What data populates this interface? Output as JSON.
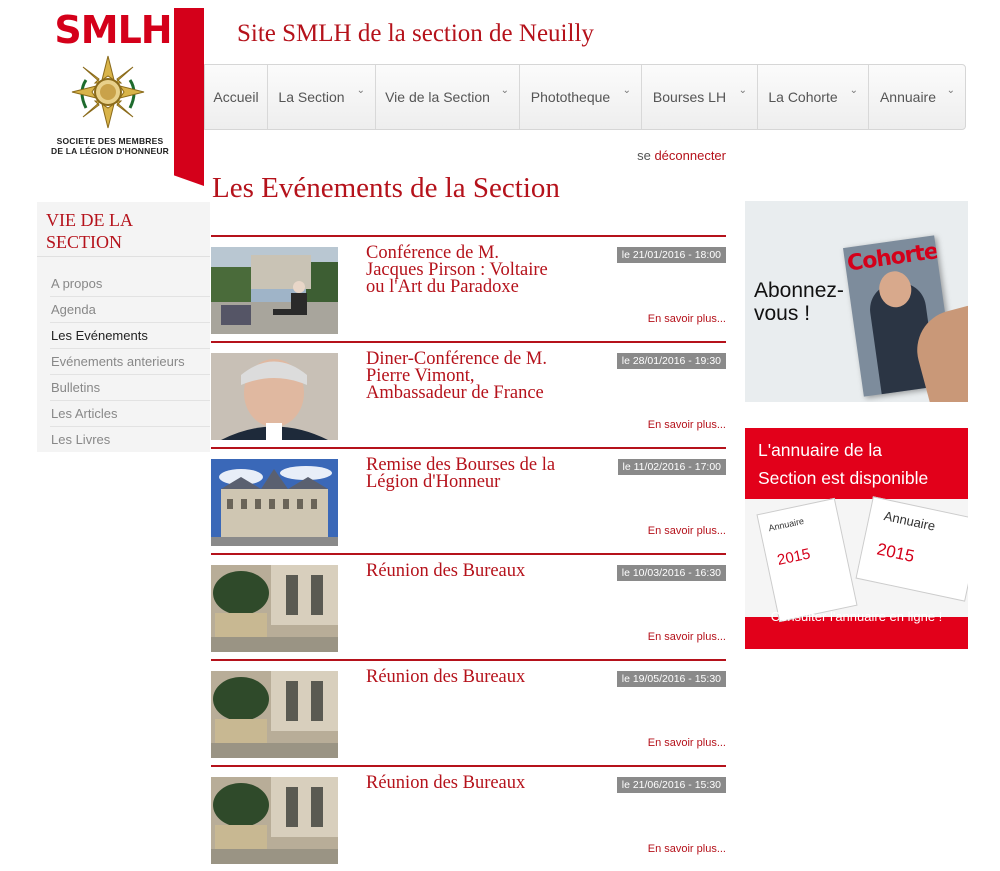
{
  "logo": {
    "text": "SMLH",
    "caption_line1": "SOCIETE DES MEMBRES",
    "caption_line2": "DE LA LÉGION D'HONNEUR"
  },
  "site_title": "Site SMLH de la section de Neuilly",
  "nav": [
    {
      "label": "Accueil",
      "dropdown": false
    },
    {
      "label": "La Section",
      "dropdown": true
    },
    {
      "label": "Vie de la Section",
      "dropdown": true
    },
    {
      "label": "Phototheque",
      "dropdown": true
    },
    {
      "label": "Bourses LH",
      "dropdown": true
    },
    {
      "label": "La Cohorte",
      "dropdown": true
    },
    {
      "label": "Annuaire",
      "dropdown": true
    }
  ],
  "logout": {
    "prefix": "se",
    "link": "déconnecter"
  },
  "page_title": "Les Evénements de la Section",
  "sidebar": {
    "heading_line1": "VIE DE LA",
    "heading_line2": "SECTION",
    "items": [
      {
        "label": "A propos"
      },
      {
        "label": "Agenda"
      },
      {
        "label": "Les Evénements",
        "active": true
      },
      {
        "label": "Evénements anterieurs"
      },
      {
        "label": "Bulletins"
      },
      {
        "label": "Les Articles"
      },
      {
        "label": "Les Livres"
      }
    ]
  },
  "events": [
    {
      "title": "Conférence de M. Jacques Pirson : Voltaire ou l'Art du Paradoxe",
      "date": "le 21/01/2016 - 18:00",
      "more": "En savoir plus...",
      "thumb": "park"
    },
    {
      "title": "Diner-Conférence de M. Pierre Vimont, Ambassadeur de France",
      "date": "le 28/01/2016 - 19:30",
      "more": "En savoir plus...",
      "thumb": "portrait"
    },
    {
      "title": "Remise des Bourses de la Légion d'Honneur",
      "date": "le 11/02/2016 - 17:00",
      "more": "En savoir plus...",
      "thumb": "building"
    },
    {
      "title": "Réunion des Bureaux",
      "date": "le 10/03/2016 - 16:30",
      "more": "En savoir plus...",
      "thumb": "courtyard"
    },
    {
      "title": "Réunion des Bureaux",
      "date": "le 19/05/2016 - 15:30",
      "more": "En savoir plus...",
      "thumb": "courtyard"
    },
    {
      "title": "Réunion des Bureaux",
      "date": "le 21/06/2016 - 15:30",
      "more": "En savoir plus...",
      "thumb": "courtyard"
    }
  ],
  "cohorte_ad": {
    "line1": "Abonnez-",
    "line2": "vous !",
    "magazine_title": "Cohorte"
  },
  "annuaire_ad": {
    "title_line1": "L'annuaire de la",
    "title_line2": "Section est disponible",
    "book_label": "Annuaire",
    "book_year": "2015",
    "link": "Consulter l'annuaire en ligne !"
  },
  "colors": {
    "brand_red": "#b5121b",
    "banner_red": "#e2001a",
    "date_badge": "#8a8a8a"
  }
}
